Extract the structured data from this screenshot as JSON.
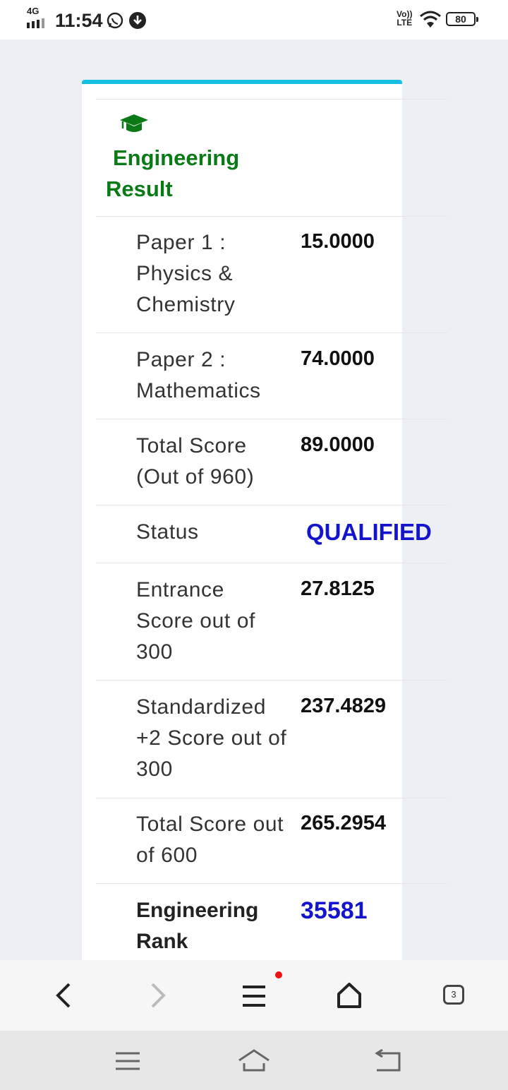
{
  "status_bar": {
    "network": "4G",
    "time": "11:54",
    "volte": "Vo))\nLTE",
    "battery": "80"
  },
  "result": {
    "title_line1": "Engineering",
    "title_line2": "Result",
    "rows": [
      {
        "label": "Paper 1 : Physics & Chemistry",
        "value": "15.0000"
      },
      {
        "label": "Paper 2 : Mathematics",
        "value": "74.0000"
      },
      {
        "label": "Total Score (Out of 960)",
        "value": "89.0000"
      },
      {
        "label": "Status",
        "value": "QUALIFIED"
      },
      {
        "label": "Entrance Score out of 300",
        "value": "27.8125"
      },
      {
        "label": "Standardized +2 Score out of 300",
        "value": "237.4829"
      },
      {
        "label": "Total Score out of 600",
        "value": "265.2954"
      },
      {
        "label": "Engineering Rank",
        "value": "35581"
      }
    ]
  },
  "browser_nav": {
    "tab_count": "3"
  },
  "colors": {
    "accent_bar": "#17c0e0",
    "title_green": "#0a7a16",
    "highlight_blue": "#1414cc"
  }
}
